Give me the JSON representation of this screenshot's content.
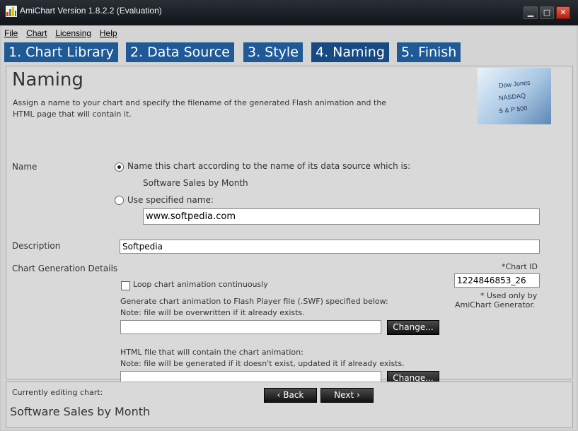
{
  "window": {
    "title": "AmiChart Version 1.8.2.2 (Evaluation)",
    "minimize_glyph": "▁",
    "maximize_glyph": "□",
    "close_glyph": "✕"
  },
  "menu": [
    "File",
    "Chart",
    "Licensing",
    "Help"
  ],
  "tabs": [
    {
      "label": "1. Chart Library"
    },
    {
      "label": "2. Data Source"
    },
    {
      "label": "3. Style"
    },
    {
      "label": "4. Naming"
    },
    {
      "label": "5. Finish"
    }
  ],
  "naming": {
    "title": "Naming",
    "description": "Assign a name to your chart and specify the filename of the generated Flash animation and the HTML page that will contain it.",
    "hero_lines": [
      "Dow Jones",
      "NASDAQ",
      "S & P 500"
    ]
  },
  "name_section": {
    "label": "Name",
    "option_datasource": "Name this chart according to the name of its data source which is:",
    "datasource_name": "Software Sales by Month",
    "option_specified": "Use specified name:",
    "specified_value": "www.softpedia.com"
  },
  "description_section": {
    "label": "Description",
    "value": "Softpedia"
  },
  "generation": {
    "label": "Chart Generation Details",
    "chart_id_label": "*Chart ID",
    "chart_id": "1224846853_26",
    "note_line1": "* Used only by",
    "note_line2": "AmiChart Generator.",
    "loop_label": "Loop chart animation continuously",
    "swf_line1": "Generate chart animation to Flash Player file (.SWF) specified below:",
    "swf_line2": "Note: file will be overwritten if it already exists.",
    "swf_path": "",
    "swf_change": "Change...",
    "html_line1": "HTML file that will contain the chart animation:",
    "html_line2": "Note: file will be generated if it doesn't exist, updated it if already exists.",
    "html_path": "",
    "html_change": "Change..."
  },
  "footer": {
    "editing_label": "Currently editing chart:",
    "editing_name": "Software Sales by Month",
    "back": "‹ Back",
    "next": "Next ›"
  },
  "colors": {
    "tab": "#1f5a97",
    "tab_active": "#174a82"
  }
}
